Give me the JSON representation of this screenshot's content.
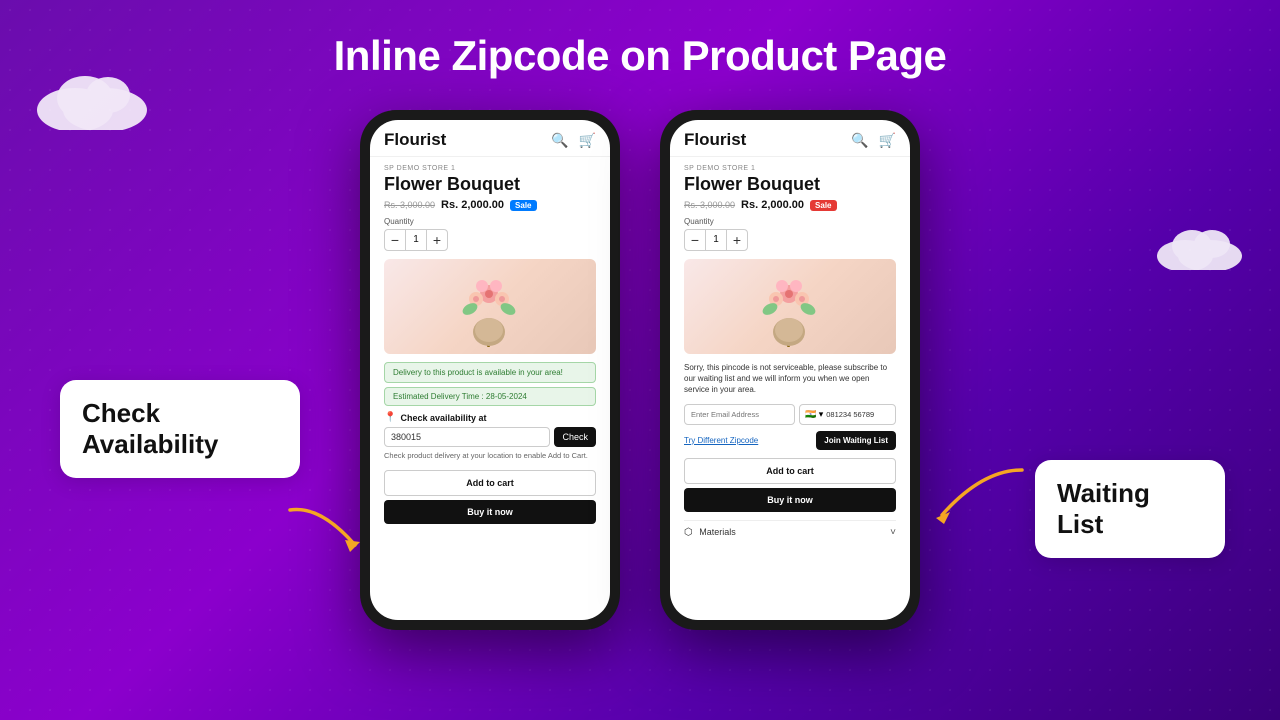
{
  "page": {
    "title": "Inline Zipcode on Product Page",
    "background_gradient": "purple"
  },
  "labels": {
    "check_availability": "Check\nAvailability",
    "waiting_list": "Waiting\nList"
  },
  "phone1": {
    "store_name": "Flourist",
    "store_label": "SP DEMO STORE 1",
    "product_title": "Flower Bouquet",
    "price_original": "Rs. 3,000.00",
    "price_current": "Rs. 2,000.00",
    "sale_badge": "Sale",
    "quantity_label": "Quantity",
    "quantity_value": "1",
    "qty_minus": "−",
    "qty_plus": "+",
    "availability_msg": "Delivery to this product is available in your area!",
    "delivery_time": "Estimated Delivery Time : 28-05-2024",
    "check_at_label": "Check availability at",
    "zipcode_value": "380015",
    "check_btn_label": "Check",
    "delivery_note": "Check product delivery at your location to enable Add to Cart.",
    "add_to_cart": "Add to cart",
    "buy_now": "Buy it now"
  },
  "phone2": {
    "store_name": "Flourist",
    "store_label": "SP DEMO STORE 1",
    "product_title": "Flower Bouquet",
    "price_original": "Rs. 3,000.00",
    "price_current": "Rs. 2,000.00",
    "sale_badge": "Sale",
    "quantity_label": "Quantity",
    "quantity_value": "1",
    "qty_minus": "−",
    "qty_plus": "+",
    "sorry_msg": "Sorry, this pincode is not serviceable, please subscribe to our waiting list and we will inform you when we open service in your area.",
    "email_placeholder": "Enter Email Address",
    "flag": "🇮🇳",
    "phone_number": "081234 56789",
    "try_different": "Try Different Zipcode",
    "join_waiting": "Join Waiting List",
    "add_to_cart": "Add to cart",
    "buy_now": "Buy it now",
    "materials_label": "Materials",
    "search_icon": "🔍",
    "cart_icon": "🛒"
  },
  "icons": {
    "search": "🔍",
    "cart": "🛒",
    "pin": "📍",
    "chevron_down": "˅"
  }
}
